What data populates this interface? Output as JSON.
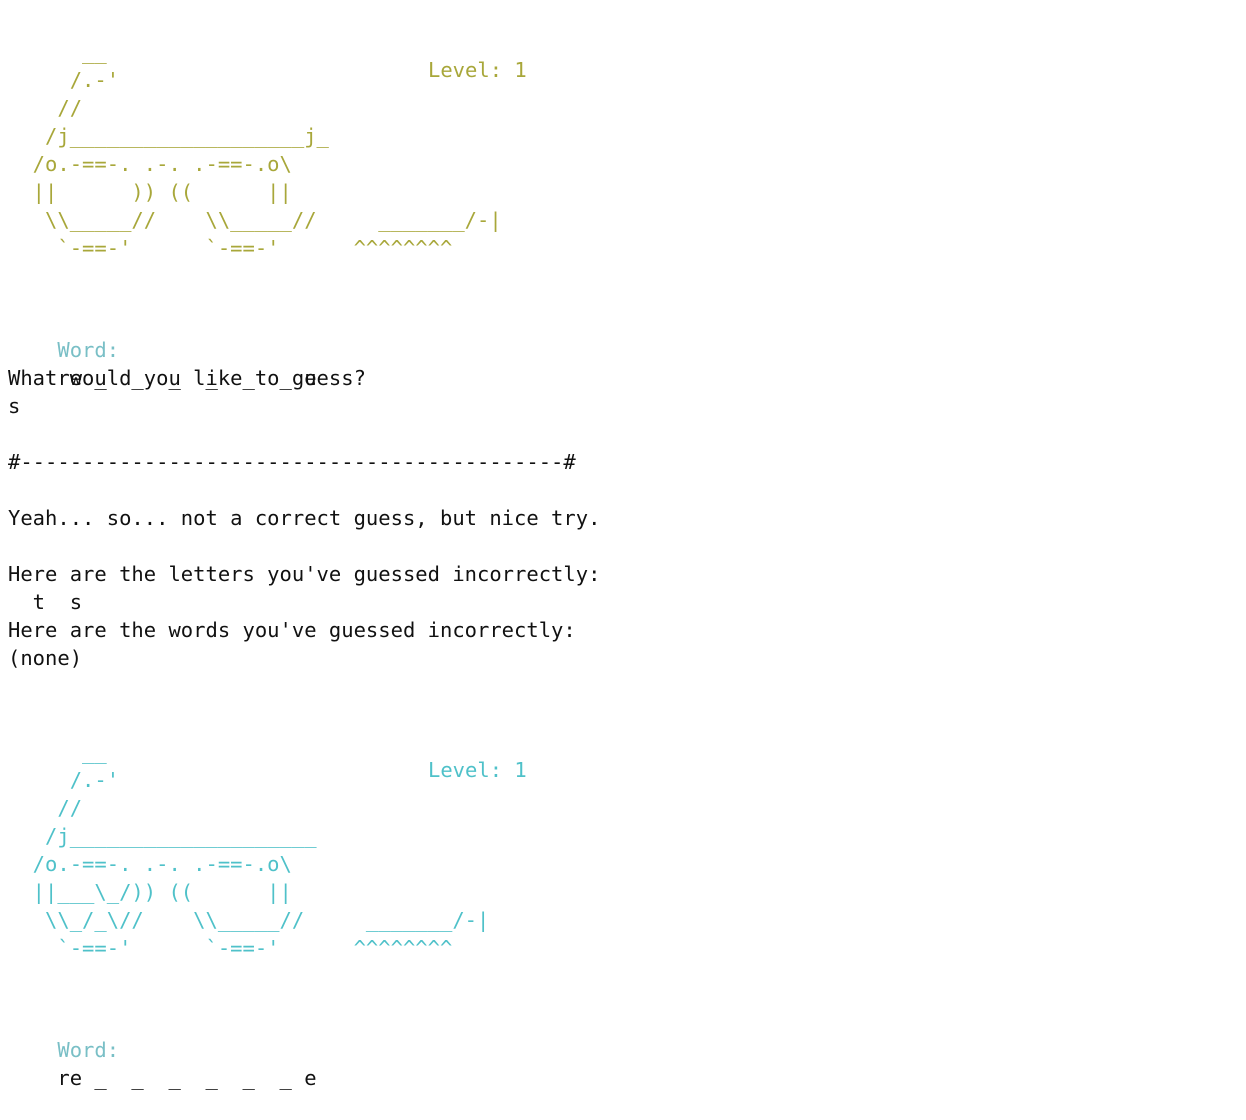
{
  "colors": {
    "round1_art": "#a8a73a",
    "round2_art": "#4fc1c9",
    "word_label": "#79bfc6",
    "text": "#111111",
    "background": "#ffffff"
  },
  "round1": {
    "art": "      __\n     /.-'\n    //\n   /j___________________j_\n  /o.-==-. .-. .-==-.o\\\n  ||      )) ((      ||\n   \\\\_____//    \\\\_____//     _______/-|\n    `-==-'      `-==-'      ^^^^^^^^",
    "level": "Level: 1",
    "word_label": "Word:",
    "word_value": "re _  _  _  _  _  _ e"
  },
  "prompt": "What would you like to guess?",
  "guess": "s",
  "divider": "#--------------------------------------------#",
  "feedback": "Yeah... so... not a correct guess, but nice try.",
  "letters_header": "Here are the letters you've guessed incorrectly:",
  "letters_value": "  t  s",
  "words_header": "Here are the words you've guessed incorrectly:",
  "words_value": "(none)",
  "round2": {
    "art": "      __\n     /.-'\n    //\n   /j____________________\n  /o.-==-. .-. .-==-.o\\\n  ||___\\_/)) ((      ||\n   \\\\_/_\\//    \\\\_____//     _______/-|\n    `-==-'      `-==-'      ^^^^^^^^",
    "level": "Level: 1",
    "word_label": "Word:",
    "word_value": "re _  _  _  _  _  _ e"
  }
}
